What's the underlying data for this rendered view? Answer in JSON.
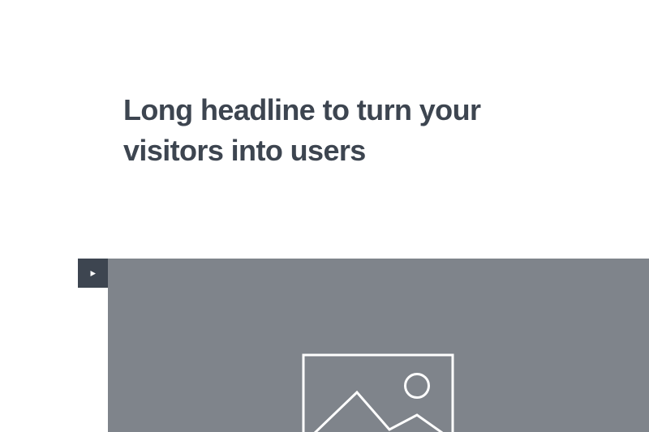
{
  "hero": {
    "headline_line_1": "Long headline to turn your",
    "headline_line_2": "visitors into users"
  },
  "media": {
    "play_icon": "play-icon",
    "placeholder_icon": "image-placeholder-icon"
  },
  "colors": {
    "background": "#ffffff",
    "headline_text": "#3d4550",
    "play_button_bg": "#3d4550",
    "media_bg": "#7f848b",
    "icon_stroke": "#ffffff"
  }
}
